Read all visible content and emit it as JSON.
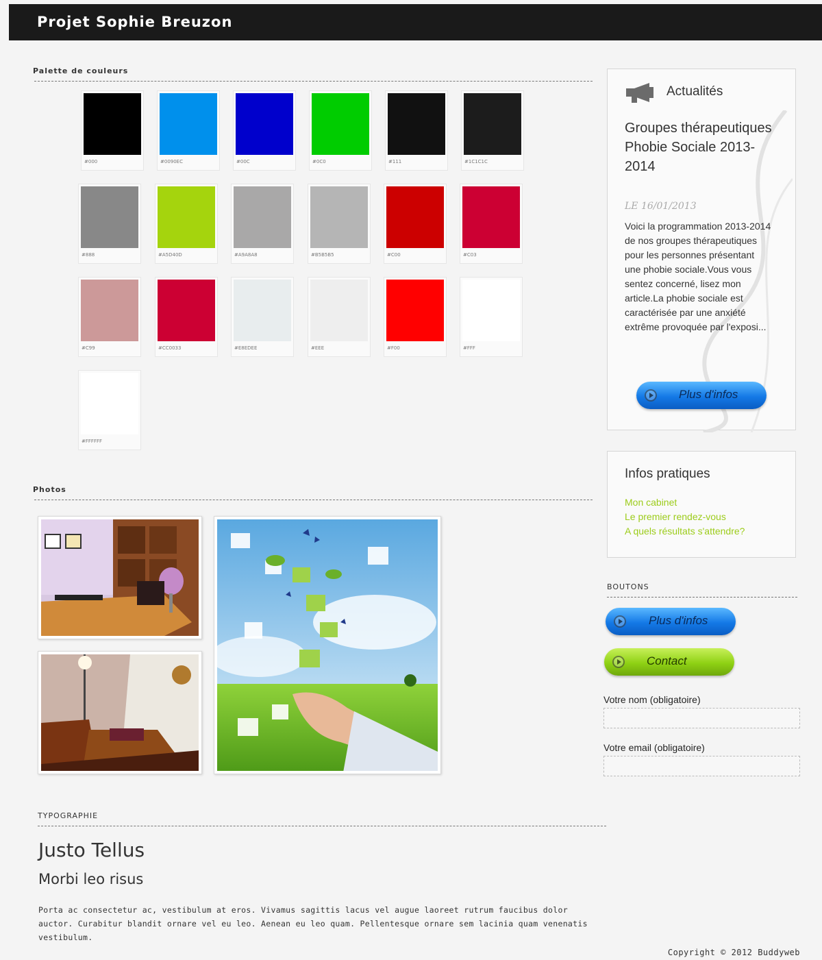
{
  "header": {
    "title": "Projet Sophie Breuzon"
  },
  "palette": {
    "label": "Palette de couleurs",
    "swatches": [
      {
        "color": "#000000",
        "code": "#000"
      },
      {
        "color": "#0090EC",
        "code": "#0090EC"
      },
      {
        "color": "#0000CC",
        "code": "#00C"
      },
      {
        "color": "#00CC00",
        "code": "#0C0"
      },
      {
        "color": "#111111",
        "code": "#111"
      },
      {
        "color": "#1C1C1C",
        "code": "#1C1C1C"
      },
      {
        "color": "#888888",
        "code": "#888"
      },
      {
        "color": "#A5D40D",
        "code": "#A5D40D"
      },
      {
        "color": "#A9A8A8",
        "code": "#A9A8A8"
      },
      {
        "color": "#B5B5B5",
        "code": "#B5B5B5"
      },
      {
        "color": "#CC0000",
        "code": "#C00"
      },
      {
        "color": "#CC0033",
        "code": "#C03"
      },
      {
        "color": "#CC9999",
        "code": "#C99"
      },
      {
        "color": "#CC0033",
        "code": "#CC0033"
      },
      {
        "color": "#E8EDEE",
        "code": "#E8EDEE"
      },
      {
        "color": "#EEEEEE",
        "code": "#EEE"
      },
      {
        "color": "#FF0000",
        "code": "#F00"
      },
      {
        "color": "#FFFFFF",
        "code": "#FFF"
      },
      {
        "color": "#FFFFFF",
        "code": "#FFFFFF"
      }
    ]
  },
  "photos": {
    "label": "Photos"
  },
  "news": {
    "title": "Actualités",
    "heading": "Groupes thérapeutiques Phobie Sociale 2013-2014",
    "date": "LE 16/01/2013",
    "text": "Voici la programmation 2013-2014 de nos groupes thérapeutiques pour les personnes présentant une phobie sociale.Vous vous sentez concerné, lisez mon article.La phobie sociale est caractérisée par une anxiété extrême provoquée par l'exposi...",
    "button": "Plus d'infos"
  },
  "infos": {
    "title": "Infos pratiques",
    "links": [
      "Mon cabinet",
      "Le premier rendez-vous",
      "A quels résultats s'attendre?"
    ]
  },
  "buttons": {
    "label": "BOUTONS",
    "more": "Plus d'infos",
    "contact": "Contact"
  },
  "form": {
    "name_label": "Votre nom (obligatoire)",
    "name_value": "",
    "email_label": "Votre email (obligatoire)",
    "email_value": ""
  },
  "typography": {
    "label": "TYPOGRAPHIE",
    "h1": "Justo Tellus",
    "h2": "Morbi leo risus",
    "paragraph": "Porta ac consectetur ac, vestibulum at eros. Vivamus sagittis lacus vel augue laoreet rutrum faucibus dolor auctor. Curabitur blandit ornare vel eu leo. Aenean eu leo quam. Pellentesque ornare sem lacinia quam venenatis vestibulum."
  },
  "footer": {
    "copyright": "Copyright © 2012 Buddyweb"
  },
  "colors": {
    "accent_blue": "#1479E6",
    "accent_green": "#8FD114",
    "link_green": "#9CCC1A",
    "header_bg": "#1A1A1A"
  },
  "icons": [
    "megaphone-icon",
    "play-circle-icon"
  ]
}
